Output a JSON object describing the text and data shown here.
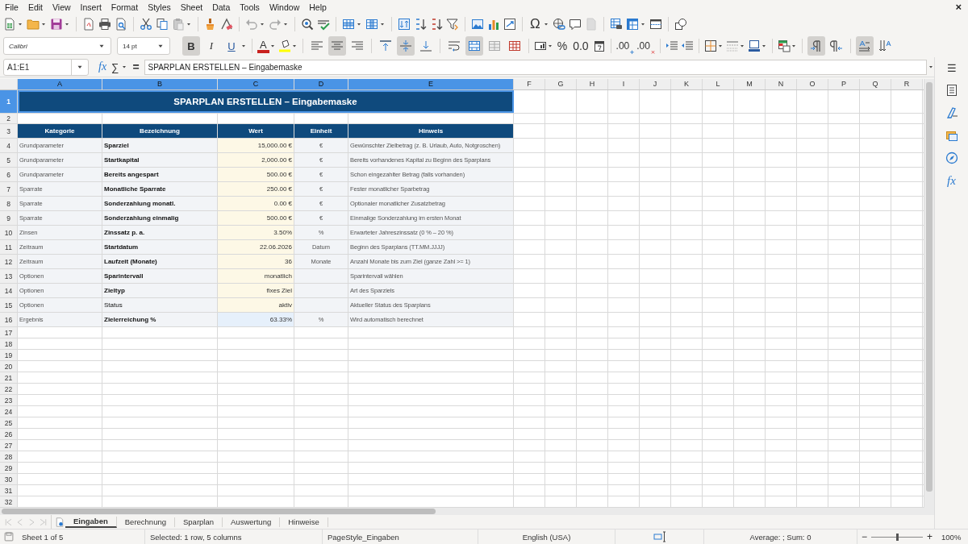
{
  "menu": [
    "File",
    "Edit",
    "View",
    "Insert",
    "Format",
    "Styles",
    "Sheet",
    "Data",
    "Tools",
    "Window",
    "Help"
  ],
  "close_glyph": "×",
  "standard_toolbar": {
    "special_character_glyph": "Ω"
  },
  "formatting_toolbar": {
    "font_name": "Calibri",
    "font_size": "14 pt",
    "bold_glyph": "B",
    "italic_glyph": "I",
    "underline_glyph": "U",
    "font_color_glyph": "A",
    "percent_glyph": "%",
    "number_glyph": "0.0",
    "add_decimal_glyph": ".00",
    "delete_decimal_glyph": ".00",
    "toggles": {
      "bold": true,
      "italic": false,
      "underline": false,
      "align_left": false,
      "align_center": true,
      "align_right": false,
      "align_top": false,
      "align_middle": true,
      "align_bottom": false,
      "wrap_text": false,
      "merge_and_center": true,
      "merge_cells": false,
      "unmerge_cells": false,
      "left_to_right": true,
      "right_to_left": false,
      "text_horizontal": true,
      "text_vertical": false
    }
  },
  "formula_bar": {
    "name_box": "A1:E1",
    "function_glyph": "fx",
    "sum_glyph": "∑",
    "equals_glyph": "=",
    "content": "SPARPLAN ERSTELLEN – Eingabemaske"
  },
  "sidebar": {
    "menu_glyph": "☰",
    "functions_glyph": "fx"
  },
  "sheet": {
    "columns": [
      {
        "label": "A",
        "selected": true
      },
      {
        "label": "B",
        "selected": true
      },
      {
        "label": "C",
        "selected": true
      },
      {
        "label": "D",
        "selected": true
      },
      {
        "label": "E",
        "selected": true
      },
      {
        "label": "F",
        "selected": false
      },
      {
        "label": "G",
        "selected": false
      },
      {
        "label": "H",
        "selected": false
      },
      {
        "label": "I",
        "selected": false
      },
      {
        "label": "J",
        "selected": false
      },
      {
        "label": "K",
        "selected": false
      },
      {
        "label": "L",
        "selected": false
      },
      {
        "label": "M",
        "selected": false
      },
      {
        "label": "N",
        "selected": false
      },
      {
        "label": "O",
        "selected": false
      },
      {
        "label": "P",
        "selected": false
      },
      {
        "label": "Q",
        "selected": false
      },
      {
        "label": "R",
        "selected": false
      }
    ],
    "title_row": {
      "row": "1",
      "text": "SPARPLAN ERSTELLEN – Eingabemaske",
      "selected": true
    },
    "spacer_row": "2",
    "header_row": {
      "row": "3",
      "cells": [
        "Kategorie",
        "Bezeichnung",
        "Wert",
        "Einheit",
        "Hinweis"
      ]
    },
    "rows": [
      {
        "row": "4",
        "category": "Grundparameter",
        "label": "Sparziel",
        "label_bold": true,
        "value": "15,000.00 €",
        "unit": "€",
        "hint": "Gewünschter Zielbetrag (z. B. Urlaub, Auto, Notgroschen)",
        "kind": "input"
      },
      {
        "row": "5",
        "category": "Grundparameter",
        "label": "Startkapital",
        "label_bold": true,
        "value": "2,000.00 €",
        "unit": "€",
        "hint": "Bereits vorhandenes Kapital zu Beginn des Sparplans",
        "kind": "input"
      },
      {
        "row": "6",
        "category": "Grundparameter",
        "label": "Bereits angespart",
        "label_bold": true,
        "value": "500.00 €",
        "unit": "€",
        "hint": "Schon eingezahlter Betrag (falls vorhanden)",
        "kind": "input"
      },
      {
        "row": "7",
        "category": "Sparrate",
        "label": "Monatliche Sparrate",
        "label_bold": true,
        "value": "250.00 €",
        "unit": "€",
        "hint": "Fester monatlicher Sparbetrag",
        "kind": "input"
      },
      {
        "row": "8",
        "category": "Sparrate",
        "label": "Sonderzahlung monatl.",
        "label_bold": true,
        "value": "0.00 €",
        "unit": "€",
        "hint": "Optionaler monatlicher Zusatzbetrag",
        "kind": "input"
      },
      {
        "row": "9",
        "category": "Sparrate",
        "label": "Sonderzahlung einmalig",
        "label_bold": true,
        "value": "500.00 €",
        "unit": "€",
        "hint": "Einmalige Sonderzahlung im ersten Monat",
        "kind": "input"
      },
      {
        "row": "10",
        "category": "Zinsen",
        "label": "Zinssatz p. a.",
        "label_bold": true,
        "value": "3.50%",
        "unit": "%",
        "hint": "Erwarteter Jahreszinssatz (0 % – 20 %)",
        "kind": "input"
      },
      {
        "row": "11",
        "category": "Zeitraum",
        "label": "Startdatum",
        "label_bold": true,
        "value": "22.06.2026",
        "unit": "Datum",
        "hint": "Beginn des Sparplans (TT.MM.JJJJ)",
        "kind": "input"
      },
      {
        "row": "12",
        "category": "Zeitraum",
        "label": "Laufzeit (Monate)",
        "label_bold": true,
        "value": "36",
        "unit": "Monate",
        "hint": "Anzahl Monate bis zum Ziel (ganze Zahl >= 1)",
        "kind": "input"
      },
      {
        "row": "13",
        "category": "Optionen",
        "label": "Sparintervall",
        "label_bold": true,
        "value": "monatlich",
        "hint": "Sparintervall wählen",
        "kind": "input"
      },
      {
        "row": "14",
        "category": "Optionen",
        "label": "Zieltyp",
        "label_bold": true,
        "value": "fixes Ziel",
        "hint": "Art des Sparziels",
        "kind": "input"
      },
      {
        "row": "15",
        "category": "Optionen",
        "label": "Status",
        "label_bold": false,
        "value": "aktiv",
        "hint": "Aktueller Status des Sparplans",
        "kind": "input"
      },
      {
        "row": "16",
        "category": "Ergebnis",
        "label": "Zielerreichung %",
        "label_bold": true,
        "value": "63.33%",
        "unit": "%",
        "hint": "Wird automatisch berechnet",
        "kind": "result"
      }
    ],
    "empty_rows": [
      "17",
      "18",
      "19",
      "20",
      "21",
      "22",
      "23",
      "24",
      "25",
      "26",
      "27",
      "28",
      "29",
      "30",
      "31",
      "32"
    ]
  },
  "sheet_tabs": [
    {
      "label": "Eingaben",
      "selected": true
    },
    {
      "label": "Berechnung",
      "selected": false
    },
    {
      "label": "Sparplan",
      "selected": false
    },
    {
      "label": "Auswertung",
      "selected": false
    },
    {
      "label": "Hinweise",
      "selected": false
    }
  ],
  "status_bar": {
    "sheet": "Sheet 1 of 5",
    "selection": "Selected: 1 row, 5 columns",
    "page_style": "PageStyle_Eingaben",
    "language": "English (USA)",
    "summary": "Average: ; Sum: 0",
    "zoom_out_glyph": "−",
    "zoom_in_glyph": "+",
    "zoom_slider": {
      "level": 0.5
    },
    "zoom": "100%"
  }
}
